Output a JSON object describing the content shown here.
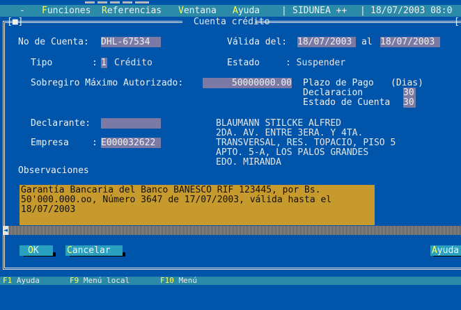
{
  "menu": {
    "items": [
      {
        "hot": "F",
        "rest": "unciones"
      },
      {
        "hot": "R",
        "rest": "eferencias"
      },
      {
        "hot": "V",
        "rest": "entana"
      },
      {
        "hot": "A",
        "rest": "yuda"
      }
    ],
    "app": "SIDUNEA ++",
    "datetime": "18/07/2003 08:0"
  },
  "window": {
    "left_marker": "[■]",
    "title": " Cuenta crédito ",
    "right_marker": "["
  },
  "account": {
    "no_cuenta_label": "No de Cuenta:",
    "no_cuenta": "DHL-67534",
    "valida_label": "Válida del:",
    "valida_from": "18/07/2003",
    "al_label": "al",
    "valida_to": "18/07/2003",
    "tipo_label": "Tipo",
    "tipo_sep": ":",
    "tipo_code": "1",
    "tipo_desc": "Crédito",
    "estado_label": "Estado",
    "estado_value": ": Suspender",
    "sobregiro_label": "Sobregiro Máximo Autorizado:",
    "sobregiro_value": "50000000.00",
    "plazo_label": "Plazo de Pago",
    "plazo_unit": "(Dias)",
    "declaracion_label": "Declaracion",
    "declaracion_value": "30",
    "estado_cuenta_label": "Estado de Cuenta",
    "estado_cuenta_value": "30",
    "declarante_label": "Declarante:",
    "declarante_value": "",
    "empresa_label": "Empresa",
    "empresa_sep": ":",
    "empresa_value": "E000032622",
    "address": [
      "BLAUMANN STILCKE ALFRED",
      "2DA. AV. ENTRE 3ERA. Y 4TA.",
      "TRANSVERSAL, RES. TOPACIO, PISO 5",
      "APTO. 5-A, LOS PALOS GRANDES",
      "EDO. MIRANDA"
    ],
    "observaciones_label": "Observaciones",
    "observaciones": [
      "Garantía Bancaria del Banco BANESCO RIF 123445, por Bs.",
      "50'000.000.oo, Número 3647 de 17/07/2003, válida hasta el",
      "18/07/2003"
    ]
  },
  "buttons": {
    "ok_hot": "O",
    "ok_rest": "K",
    "cancel_hot": "C",
    "cancel_rest": "ancelar",
    "help_hot": "A",
    "help_rest": "yuda"
  },
  "statusbar": [
    {
      "key": "F1",
      "label": "Ayuda"
    },
    {
      "key": "F9",
      "label": "Menú local"
    },
    {
      "key": "F10",
      "label": "Menú"
    }
  ],
  "colors": {
    "background": "#0055aa",
    "menubar": "#2a8aa8",
    "field": "#7a7aa5",
    "observaciones_bg": "#c79a2e",
    "hotkey": "#ffff55"
  }
}
